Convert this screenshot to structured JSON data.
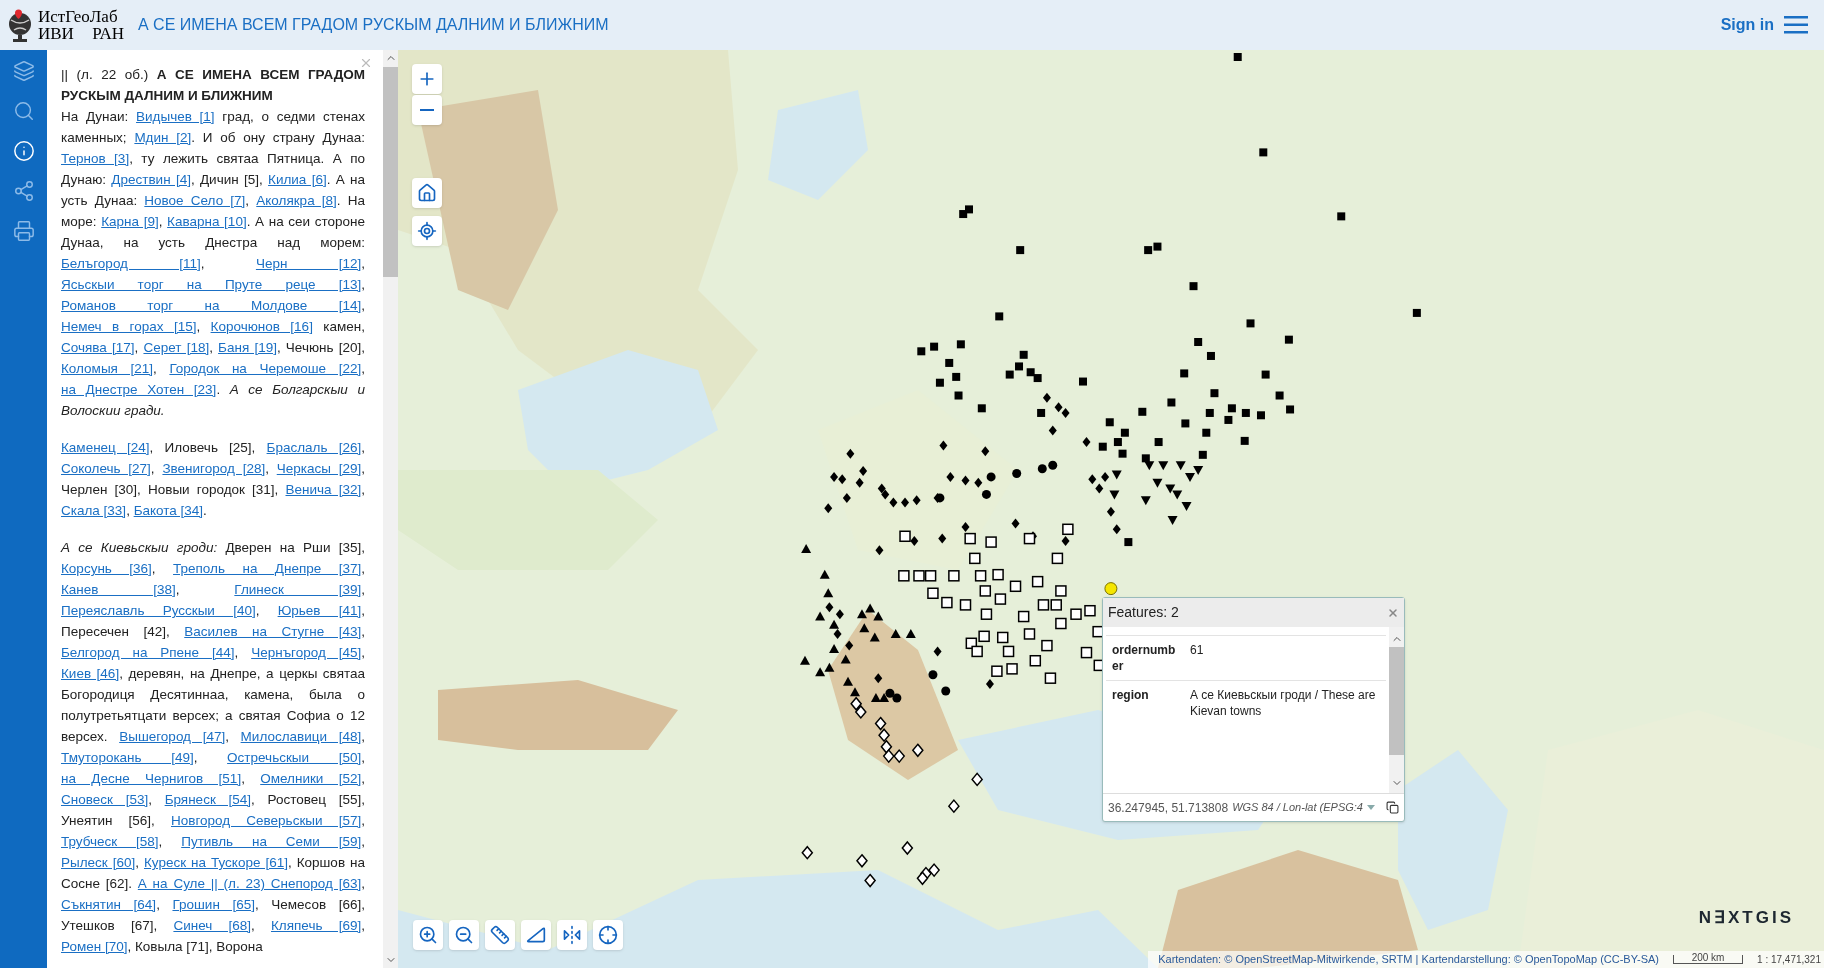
{
  "header": {
    "logo_line1": "ИстГеоЛаб",
    "logo_line2": "ИВИ РАН",
    "title": "А СЕ ИМЕНА ВСЕМ ГРАДОМ РУСКЫМ ДАЛНИМ И БЛИЖНИМ",
    "sign_in": "Sign in"
  },
  "sidebar": {
    "items": [
      {
        "selected": false
      },
      {
        "selected": false
      },
      {
        "selected": true
      },
      {
        "selected": false
      },
      {
        "selected": false
      }
    ]
  },
  "text_panel": {
    "paragraphs": [
      {
        "kind": "heading",
        "segments": [
          {
            "kind": "plain",
            "text": "|| (л. 22 об.) "
          },
          {
            "kind": "bold",
            "text": "А СЕ ИМЕНА ВСЕМ ГРАДОМ РУСКЫМ ДАЛНИМ И БЛИЖНИМ"
          }
        ]
      },
      {
        "kind": "body",
        "segments": [
          {
            "kind": "plain",
            "text": "На Дунаи: "
          },
          {
            "kind": "link",
            "text": "Видычев [1]"
          },
          {
            "kind": "plain",
            "text": " град, о седми стенах каменных; "
          },
          {
            "kind": "link",
            "text": "Мдин [2]"
          },
          {
            "kind": "plain",
            "text": ". И об ону страну Дунаа: "
          },
          {
            "kind": "link",
            "text": "Тернов [3]"
          },
          {
            "kind": "plain",
            "text": ", ту лежить святаа Пятница. А по Дунаю: "
          },
          {
            "kind": "link",
            "text": "Дрествин [4]"
          },
          {
            "kind": "plain",
            "text": ", Дичин [5], "
          },
          {
            "kind": "link",
            "text": "Килиа [6]"
          },
          {
            "kind": "plain",
            "text": ". А на усть Дунаа: "
          },
          {
            "kind": "link",
            "text": "Новое Село [7]"
          },
          {
            "kind": "plain",
            "text": ", "
          },
          {
            "kind": "link",
            "text": "Аколякра [8]"
          },
          {
            "kind": "plain",
            "text": ". На море: "
          },
          {
            "kind": "link",
            "text": "Карна [9]"
          },
          {
            "kind": "plain",
            "text": ", "
          },
          {
            "kind": "link",
            "text": "Каварна [10]"
          },
          {
            "kind": "plain",
            "text": ". А на сеи стороне Дунаа, на усть Днестра над морем: "
          },
          {
            "kind": "link",
            "text": "Белъгород [11]"
          },
          {
            "kind": "plain",
            "text": ", "
          },
          {
            "kind": "link",
            "text": "Черн [12]"
          },
          {
            "kind": "plain",
            "text": ", "
          },
          {
            "kind": "link",
            "text": "Ясьскыи торг на Пруте реце [13]"
          },
          {
            "kind": "plain",
            "text": ", "
          },
          {
            "kind": "link",
            "text": "Романов торг на Молдове [14]"
          },
          {
            "kind": "plain",
            "text": ", "
          },
          {
            "kind": "link",
            "text": "Немеч в горах [15]"
          },
          {
            "kind": "plain",
            "text": ", "
          },
          {
            "kind": "link",
            "text": "Корочюнов [16]"
          },
          {
            "kind": "plain",
            "text": " камен, "
          },
          {
            "kind": "link",
            "text": "Сочява [17]"
          },
          {
            "kind": "plain",
            "text": ", "
          },
          {
            "kind": "link",
            "text": "Серет [18]"
          },
          {
            "kind": "plain",
            "text": ", "
          },
          {
            "kind": "link",
            "text": "Баня [19]"
          },
          {
            "kind": "plain",
            "text": ", Чечюнь [20], "
          },
          {
            "kind": "link",
            "text": "Коломыя [21]"
          },
          {
            "kind": "plain",
            "text": ", "
          },
          {
            "kind": "link",
            "text": "Городок на Черемоше [22]"
          },
          {
            "kind": "plain",
            "text": ", "
          },
          {
            "kind": "link",
            "text": "на Днестре Хотен [23]"
          },
          {
            "kind": "plain",
            "text": ". "
          },
          {
            "kind": "italic",
            "text": "А се Болгарскыи и Волоскии гради."
          }
        ]
      },
      {
        "kind": "body",
        "segments": [
          {
            "kind": "link",
            "text": "Каменец [24]"
          },
          {
            "kind": "plain",
            "text": ", Иловечь [25], "
          },
          {
            "kind": "link",
            "text": "Браслаль [26]"
          },
          {
            "kind": "plain",
            "text": ", "
          },
          {
            "kind": "link",
            "text": "Соколечь [27]"
          },
          {
            "kind": "plain",
            "text": ", "
          },
          {
            "kind": "link",
            "text": "Звенигород [28]"
          },
          {
            "kind": "plain",
            "text": ", "
          },
          {
            "kind": "link",
            "text": "Черкасы [29]"
          },
          {
            "kind": "plain",
            "text": ", Черлен [30], Новыи городок [31], "
          },
          {
            "kind": "link",
            "text": "Венича [32]"
          },
          {
            "kind": "plain",
            "text": ", "
          },
          {
            "kind": "link",
            "text": "Скала [33]"
          },
          {
            "kind": "plain",
            "text": ", "
          },
          {
            "kind": "link",
            "text": "Бакота [34]"
          },
          {
            "kind": "plain",
            "text": "."
          }
        ]
      },
      {
        "kind": "body",
        "segments": [
          {
            "kind": "italic",
            "text": "А се Киевьскыи гроди:"
          },
          {
            "kind": "plain",
            "text": " Дверен на Рши [35], "
          },
          {
            "kind": "link",
            "text": "Корсунь [36]"
          },
          {
            "kind": "plain",
            "text": ", "
          },
          {
            "kind": "link",
            "text": "Треполь на Днепре [37]"
          },
          {
            "kind": "plain",
            "text": ", "
          },
          {
            "kind": "link",
            "text": "Канев [38]"
          },
          {
            "kind": "plain",
            "text": ", "
          },
          {
            "kind": "link",
            "text": "Глинеск [39]"
          },
          {
            "kind": "plain",
            "text": ", "
          },
          {
            "kind": "link",
            "text": "Переяславль Русскыи [40]"
          },
          {
            "kind": "plain",
            "text": ", "
          },
          {
            "kind": "link",
            "text": "Юрьев [41]"
          },
          {
            "kind": "plain",
            "text": ", Пересечен [42], "
          },
          {
            "kind": "link",
            "text": "Василев на Стугне [43]"
          },
          {
            "kind": "plain",
            "text": ", "
          },
          {
            "kind": "link",
            "text": "Белгород на Рпене [44]"
          },
          {
            "kind": "plain",
            "text": ", "
          },
          {
            "kind": "link",
            "text": "Чернъгород [45]"
          },
          {
            "kind": "plain",
            "text": ", "
          },
          {
            "kind": "link",
            "text": "Киев [46]"
          },
          {
            "kind": "plain",
            "text": ", деревян, на Днепре, а церкы святаа Богородиця Десятиннаа, камена, была о полутретьятцати версех; а святая Софиа о 12 версех. "
          },
          {
            "kind": "link",
            "text": "Вышегород [47]"
          },
          {
            "kind": "plain",
            "text": ", "
          },
          {
            "kind": "link",
            "text": "Милославици [48]"
          },
          {
            "kind": "plain",
            "text": ", "
          },
          {
            "kind": "link",
            "text": "Тмуторокань [49]"
          },
          {
            "kind": "plain",
            "text": ", "
          },
          {
            "kind": "link",
            "text": "Остречьскыи [50]"
          },
          {
            "kind": "plain",
            "text": ", "
          },
          {
            "kind": "link",
            "text": "на Десне Чернигов [51]"
          },
          {
            "kind": "plain",
            "text": ", "
          },
          {
            "kind": "link",
            "text": "Омелники [52]"
          },
          {
            "kind": "plain",
            "text": ", "
          },
          {
            "kind": "link",
            "text": "Сновеск [53]"
          },
          {
            "kind": "plain",
            "text": ", "
          },
          {
            "kind": "link",
            "text": "Брянеск [54]"
          },
          {
            "kind": "plain",
            "text": ", Ростовец [55], Унеятин [56], "
          },
          {
            "kind": "link",
            "text": "Новгород Северьскыи [57]"
          },
          {
            "kind": "plain",
            "text": ", "
          },
          {
            "kind": "link",
            "text": "Трубческ [58]"
          },
          {
            "kind": "plain",
            "text": ", "
          },
          {
            "kind": "link",
            "text": "Путивль на Семи [59]"
          },
          {
            "kind": "plain",
            "text": ", "
          },
          {
            "kind": "link",
            "text": "Рылеск [60]"
          },
          {
            "kind": "plain",
            "text": ", "
          },
          {
            "kind": "link",
            "text": "Куреск на Тускоре [61]"
          },
          {
            "kind": "plain",
            "text": ", Коршов на Сосне [62]. "
          },
          {
            "kind": "link",
            "text": "А на Суле || (л. 23) Снепород [63]"
          },
          {
            "kind": "plain",
            "text": ", "
          },
          {
            "kind": "link",
            "text": "Съкнятин [64]"
          },
          {
            "kind": "plain",
            "text": ", "
          },
          {
            "kind": "link",
            "text": "Грошин [65]"
          },
          {
            "kind": "plain",
            "text": ", Чемесов [66], Утешков [67], "
          },
          {
            "kind": "link",
            "text": "Синеч [68]"
          },
          {
            "kind": "plain",
            "text": ", "
          },
          {
            "kind": "link",
            "text": "Кляпечь [69]"
          },
          {
            "kind": "plain",
            "text": ", "
          },
          {
            "kind": "link",
            "text": "Ромен [70]"
          },
          {
            "kind": "plain",
            "text": ", Ковыла [71], Ворона"
          }
        ]
      }
    ]
  },
  "popup": {
    "title": "Features: 2",
    "rows": [
      {
        "key": "ordernumber",
        "value": "61"
      },
      {
        "key": "region",
        "value": "А се Киевьскыи гроди / These are Kievan towns"
      }
    ],
    "coords": "36.247945, 51.713808",
    "crs": "WGS 84 / Lon-lat (EPSG:4"
  },
  "attribution": "Kartendaten: © OpenStreetMap-Mitwirkende, SRTM | Kartendarstellung: © OpenTopoMap (CC-BY-SA)",
  "scale": {
    "distance": "200 km",
    "ratio": "1 : 17,471,321"
  },
  "brand": "N∃XTGIS"
}
